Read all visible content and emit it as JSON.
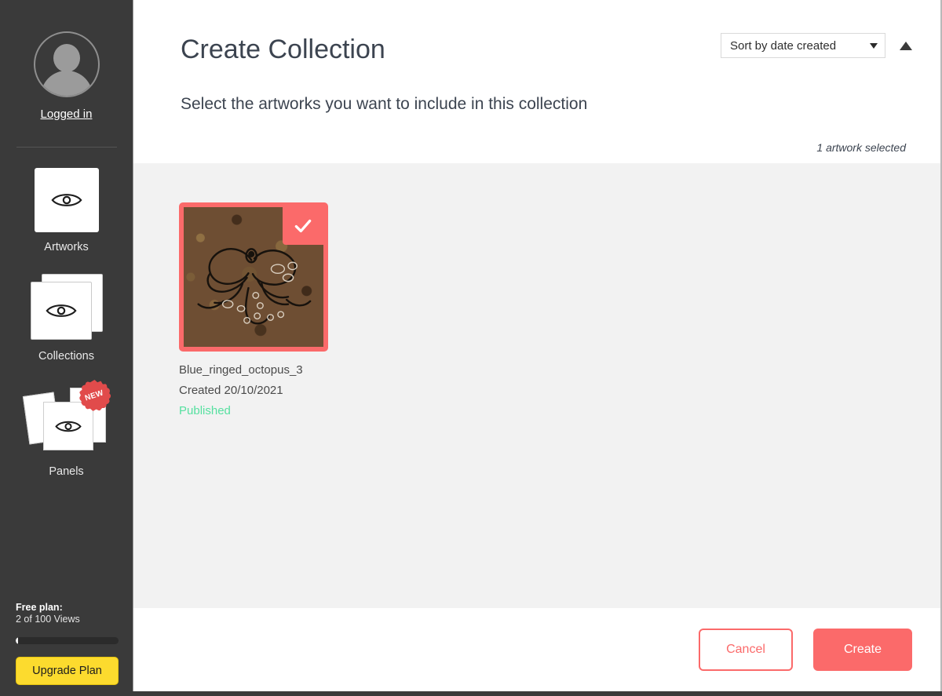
{
  "sidebar": {
    "avatar_alt": "user-avatar",
    "logged_in_label": "Logged in",
    "items": [
      {
        "label": "Artworks",
        "icon": "eye-icon"
      },
      {
        "label": "Collections",
        "icon": "eye-stack-icon"
      },
      {
        "label": "Panels",
        "icon": "eye-panels-icon",
        "badge": "NEW"
      }
    ],
    "plan": {
      "title": "Free plan:",
      "usage": "2 of 100 Views",
      "progress_percent": 2,
      "upgrade_label": "Upgrade Plan"
    }
  },
  "header": {
    "title": "Create Collection",
    "subtitle": "Select the artworks you want to include in this collection",
    "sort": {
      "selected": "Sort by date created",
      "direction_icon": "sort-ascending-icon",
      "dropdown_icon": "chevron-down-icon"
    },
    "selected_count": "1 artwork selected"
  },
  "artworks": [
    {
      "title": "Blue_ringed_octopus_3",
      "created": "Created 20/10/2021",
      "status": "Published",
      "selected": true,
      "check_icon": "checkmark-icon"
    }
  ],
  "footer": {
    "cancel_label": "Cancel",
    "create_label": "Create"
  },
  "colors": {
    "accent_red": "#fb6a6a",
    "sidebar_bg": "#3a3a3a",
    "content_bg": "#f2f2f2",
    "status_green": "#56e0a0",
    "upgrade_yellow": "#fcdb2e",
    "heading_text": "#3c4450",
    "badge_red": "#e14b4b"
  }
}
